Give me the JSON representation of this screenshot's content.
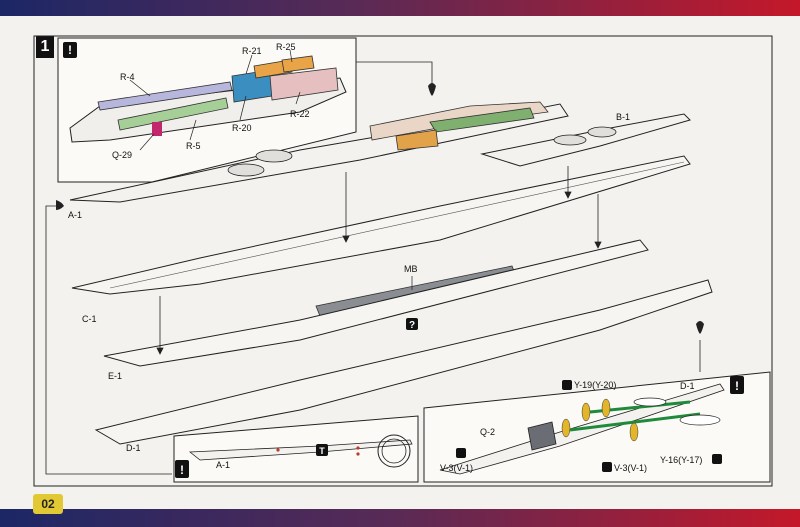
{
  "step": "1",
  "page_number": "02",
  "parts": {
    "r4": "R-4",
    "r21": "R-21",
    "r25": "R-25",
    "r20": "R-20",
    "r22": "R-22",
    "r5": "R-5",
    "q29": "Q-29",
    "a1": "A-1",
    "b1": "B-1",
    "c1": "C-1",
    "mb": "MB",
    "e1": "E-1",
    "d1": "D-1",
    "a1_detail": "A-1",
    "d1_detail": "D-1",
    "q2": "Q-2",
    "y19": "Y-19(Y-20)",
    "v3_left": "V-3(V-1)",
    "v3_right": "V-3(V-1)",
    "y16": "Y-16(Y-17)"
  },
  "symbols": {
    "attention": "!",
    "question": "?",
    "trim": "T"
  }
}
